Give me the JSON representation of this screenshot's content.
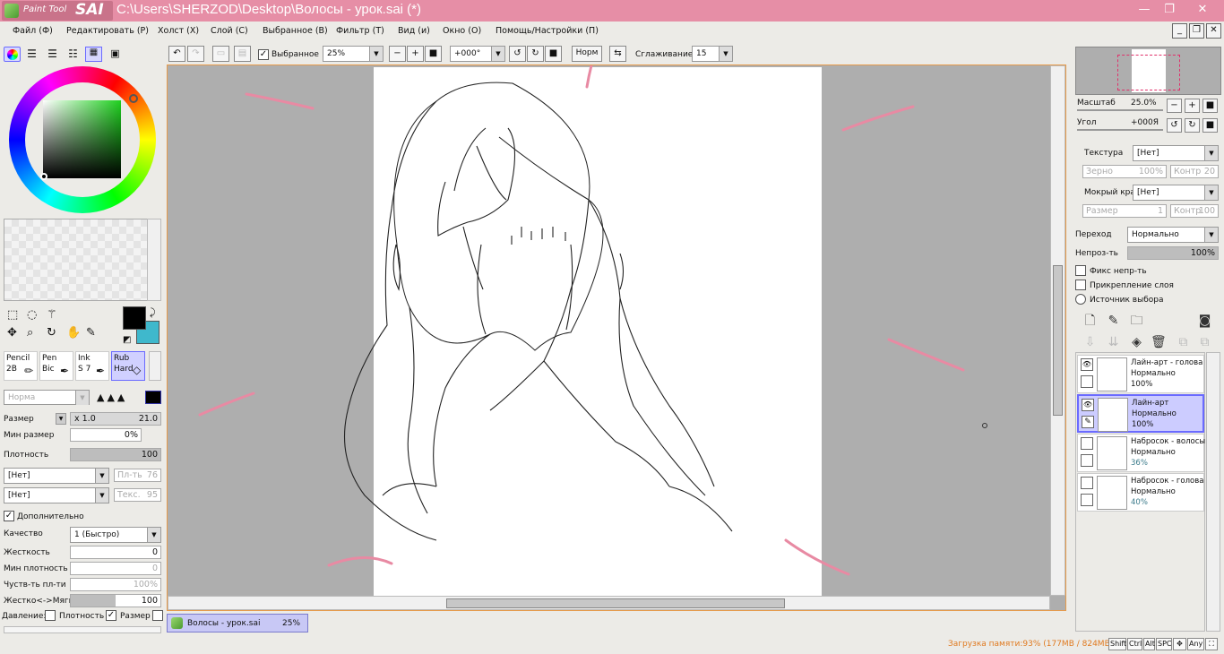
{
  "app": {
    "logo_text": "Paint Tool",
    "logo_sai": "SAI",
    "window_title": "C:\\Users\\SHERZOD\\Desktop\\Волосы - урок.sai (*)",
    "win_minimize": "—",
    "win_restore": "❐",
    "win_close": "✕"
  },
  "menu": {
    "items": [
      "Файл (Ф)",
      "Редактировать (Р)",
      "Холст (Х)",
      "Слой (С)",
      "Выбранное (В)",
      "Фильтр (Т)",
      "Вид (и)",
      "Окно (О)",
      "Помощь/Настройки (П)"
    ]
  },
  "toolbar": {
    "selection_label": "Выбранное",
    "selection_checked": true,
    "zoom_value": "25%",
    "angle_value": "+000°",
    "norm_label": "Норм",
    "smoothing_label": "Сглаживание",
    "smoothing_value": "15"
  },
  "color_panel": {
    "primary_color": "#000000",
    "secondary_color": "#3fb8cc",
    "hue_color": "#1fd11f"
  },
  "brushes": [
    {
      "name": "Pencil",
      "size": "2B"
    },
    {
      "name": "Pen",
      "size": "Bic"
    },
    {
      "name": "Ink",
      "size": "S 7"
    },
    {
      "name": "Rub",
      "size": "Hard"
    }
  ],
  "brush_settings": {
    "blend_mode": "Норма",
    "size_label": "Размер",
    "size_mult": "x 1.0",
    "size_value": "21.0",
    "min_size_label": "Мин размер",
    "min_size_value": "0%",
    "density_label": "Плотность",
    "density_value": "100",
    "texture1": "[Нет]",
    "texture1_right": "Пл-ть",
    "texture1_right_val": "76",
    "texture2": "[Нет]",
    "texture2_right": "Текс.",
    "texture2_right_val": "95",
    "advanced_label": "Дополнительно",
    "quality_label": "Качество",
    "quality_value": "1 (Быстро)",
    "hardness_label": "Жесткость",
    "hardness_value": "0",
    "min_density_label": "Мин плотность",
    "min_density_value": "0",
    "sensitivity_label": "Чуств-ть пл-ти",
    "sensitivity_value": "100%",
    "hard_soft_label": "Жестко<->Мягко",
    "hard_soft_value": "100",
    "pressure_label": "Давление:",
    "pressure_density": "Плотность",
    "pressure_size": "Размер"
  },
  "navigator": {
    "zoom_label": "Масштаб",
    "zoom_value": "25.0%",
    "angle_label": "Угол",
    "angle_value": "+000Я"
  },
  "layer_props": {
    "texture_label": "Текстура",
    "texture_value": "[Нет]",
    "grain_label": "Зерно",
    "grain_value": "100%",
    "contrast_label": "Контр",
    "contrast_value": "20",
    "wet_edge_label": "Мокрый край",
    "wet_edge_value": "[Нет]",
    "size_label": "Размер",
    "size_value": "1",
    "contrast2_label": "Контр",
    "contrast2_value": "100",
    "blend_label": "Переход",
    "blend_value": "Нормально",
    "opacity_label": "Непроз-ть",
    "opacity_value": "100%",
    "fix_opacity": "Фикс непр-ть",
    "clip_layer": "Прикрепление слоя",
    "selection_source": "Источник выбора"
  },
  "layers": [
    {
      "name": "Лайн-арт - голова",
      "mode": "Нормально",
      "opacity": "100%",
      "visible": true,
      "selected": false
    },
    {
      "name": "Лайн-арт",
      "mode": "Нормально",
      "opacity": "100%",
      "visible": true,
      "selected": true
    },
    {
      "name": "Набросок - волосы",
      "mode": "Нормально",
      "opacity": "36%",
      "visible": false,
      "selected": false
    },
    {
      "name": "Набросок - голова",
      "mode": "Нормально",
      "opacity": "40%",
      "visible": false,
      "selected": false
    }
  ],
  "doc_tab": {
    "name": "Волосы - урок.sai",
    "zoom": "25%"
  },
  "status": {
    "memory": "Загрузка памяти:93% (177MB / 824MB)",
    "keys": [
      "Shift",
      "Ctrl",
      "Alt",
      "SPC",
      "Any"
    ]
  }
}
